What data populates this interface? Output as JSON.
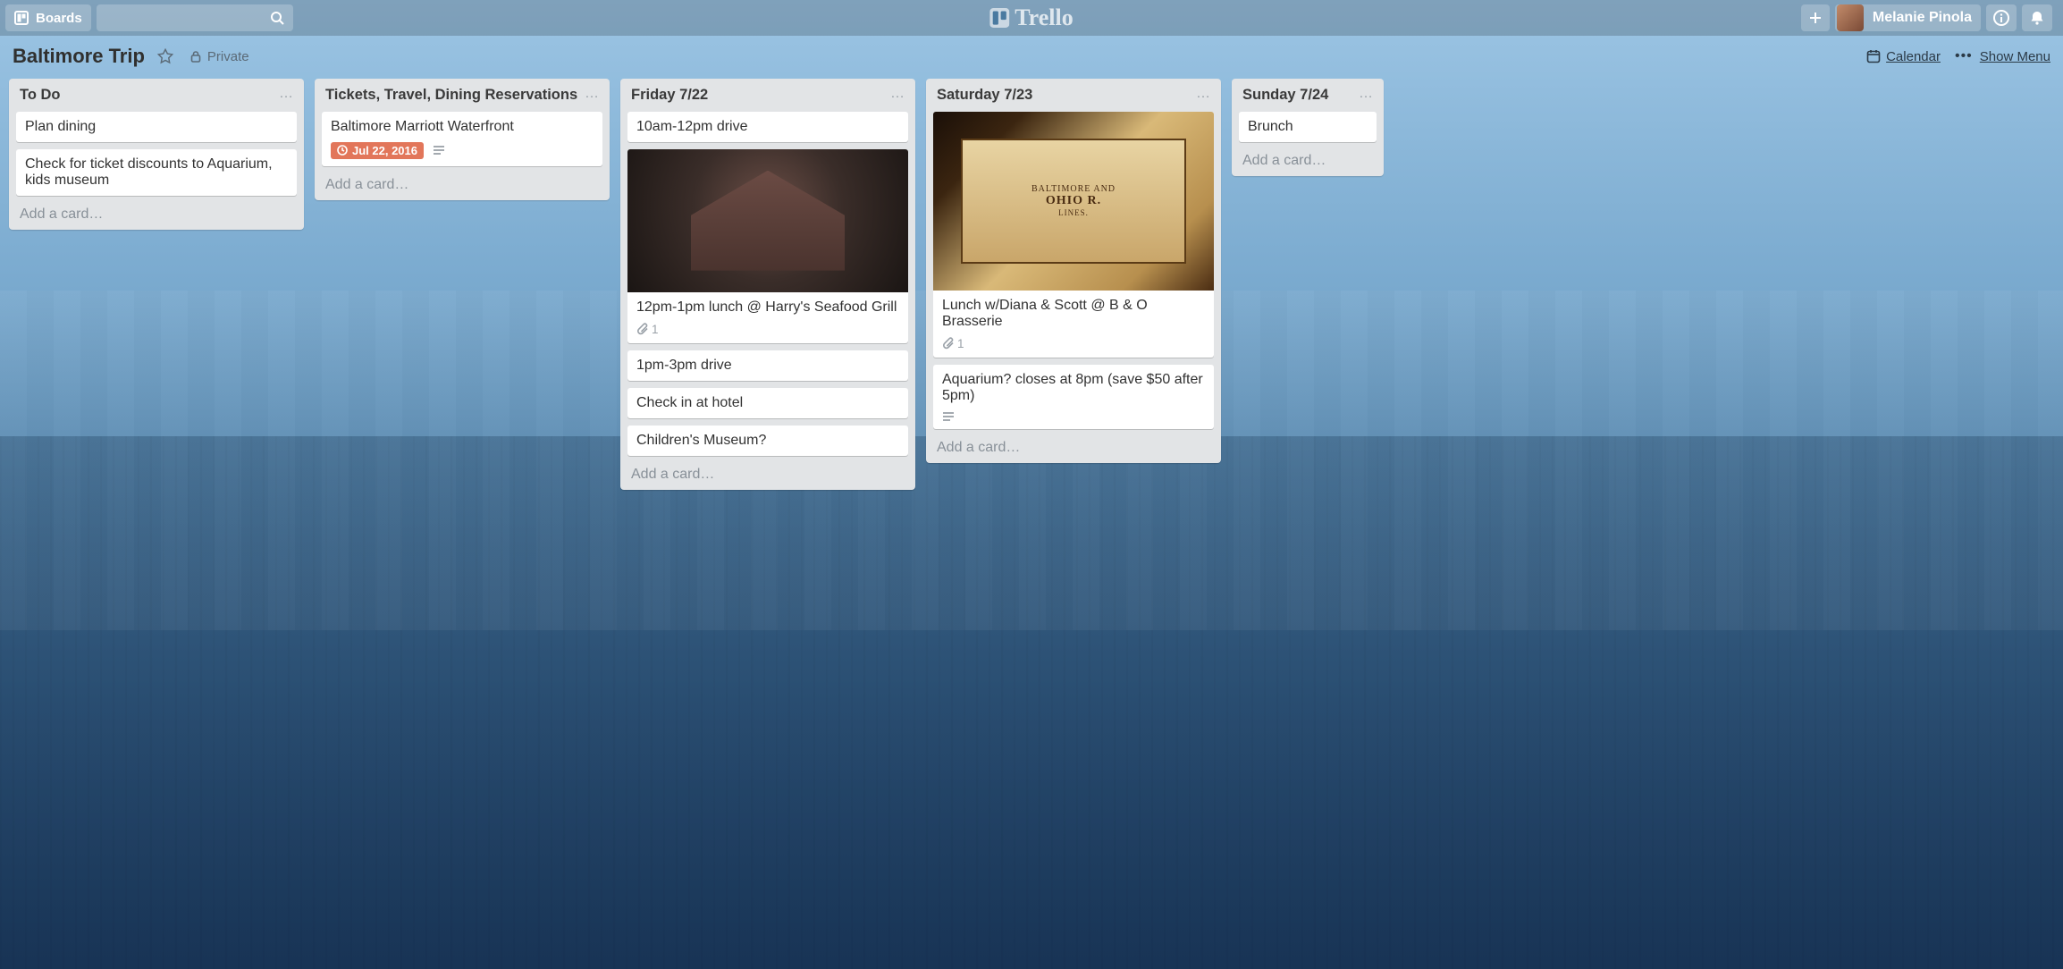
{
  "header": {
    "boards_label": "Boards",
    "app_name": "Trello",
    "user_name": "Melanie Pinola"
  },
  "board": {
    "name": "Baltimore Trip",
    "visibility": "Private",
    "calendar_label": "Calendar",
    "show_menu_label": "Show Menu"
  },
  "add_card_label": "Add a card…",
  "lists": [
    {
      "title": "To Do",
      "cards": [
        {
          "text": "Plan dining"
        },
        {
          "text": "Check for ticket discounts to Aquarium, kids museum"
        }
      ]
    },
    {
      "title": "Tickets, Travel, Dining Reservations",
      "cards": [
        {
          "text": "Baltimore Marriott Waterfront",
          "due": "Jul 22, 2016",
          "has_desc": true
        }
      ]
    },
    {
      "title": "Friday 7/22",
      "cards": [
        {
          "text": "10am-12pm drive"
        },
        {
          "text": "12pm-1pm lunch @ Harry's Seafood Grill",
          "cover": "restaurant",
          "attachments": "1"
        },
        {
          "text": "1pm-3pm drive"
        },
        {
          "text": "Check in at hotel"
        },
        {
          "text": "Children's Museum?"
        }
      ]
    },
    {
      "title": "Saturday 7/23",
      "cards": [
        {
          "text": "Lunch w/Diana & Scott @ B & O Brasserie",
          "cover": "museum",
          "attachments": "1"
        },
        {
          "text": "Aquarium? closes at 8pm (save $50 after 5pm)",
          "has_desc": true
        }
      ]
    },
    {
      "title": "Sunday 7/24",
      "narrow": true,
      "cards": [
        {
          "text": "Brunch"
        }
      ]
    }
  ]
}
